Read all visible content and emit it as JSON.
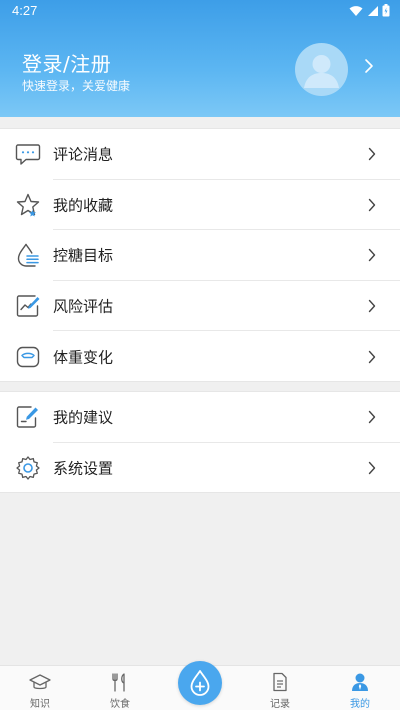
{
  "status_bar": {
    "time": "4:27"
  },
  "profile": {
    "title": "登录/注册",
    "subtitle": "快速登录，关爱健康"
  },
  "menu_group_1": [
    {
      "label": "评论消息",
      "icon": "comment-icon"
    },
    {
      "label": "我的收藏",
      "icon": "star-icon"
    },
    {
      "label": "控糖目标",
      "icon": "water-drop-icon"
    },
    {
      "label": "风险评估",
      "icon": "chart-edit-icon"
    },
    {
      "label": "体重变化",
      "icon": "scale-icon"
    }
  ],
  "menu_group_2": [
    {
      "label": "我的建议",
      "icon": "edit-note-icon"
    },
    {
      "label": "系统设置",
      "icon": "gear-icon"
    }
  ],
  "bottom_nav": {
    "items": [
      {
        "label": "知识",
        "icon": "graduation-cap-icon"
      },
      {
        "label": "饮食",
        "icon": "fork-knife-icon"
      },
      {
        "label": "记录",
        "icon": "document-icon"
      },
      {
        "label": "我的",
        "icon": "user-icon",
        "active": true
      }
    ],
    "fab_icon": "drop-plus-icon"
  },
  "colors": {
    "accent": "#3a98e4",
    "header_top": "#3d9ee8",
    "header_bottom": "#7cc8f6"
  }
}
